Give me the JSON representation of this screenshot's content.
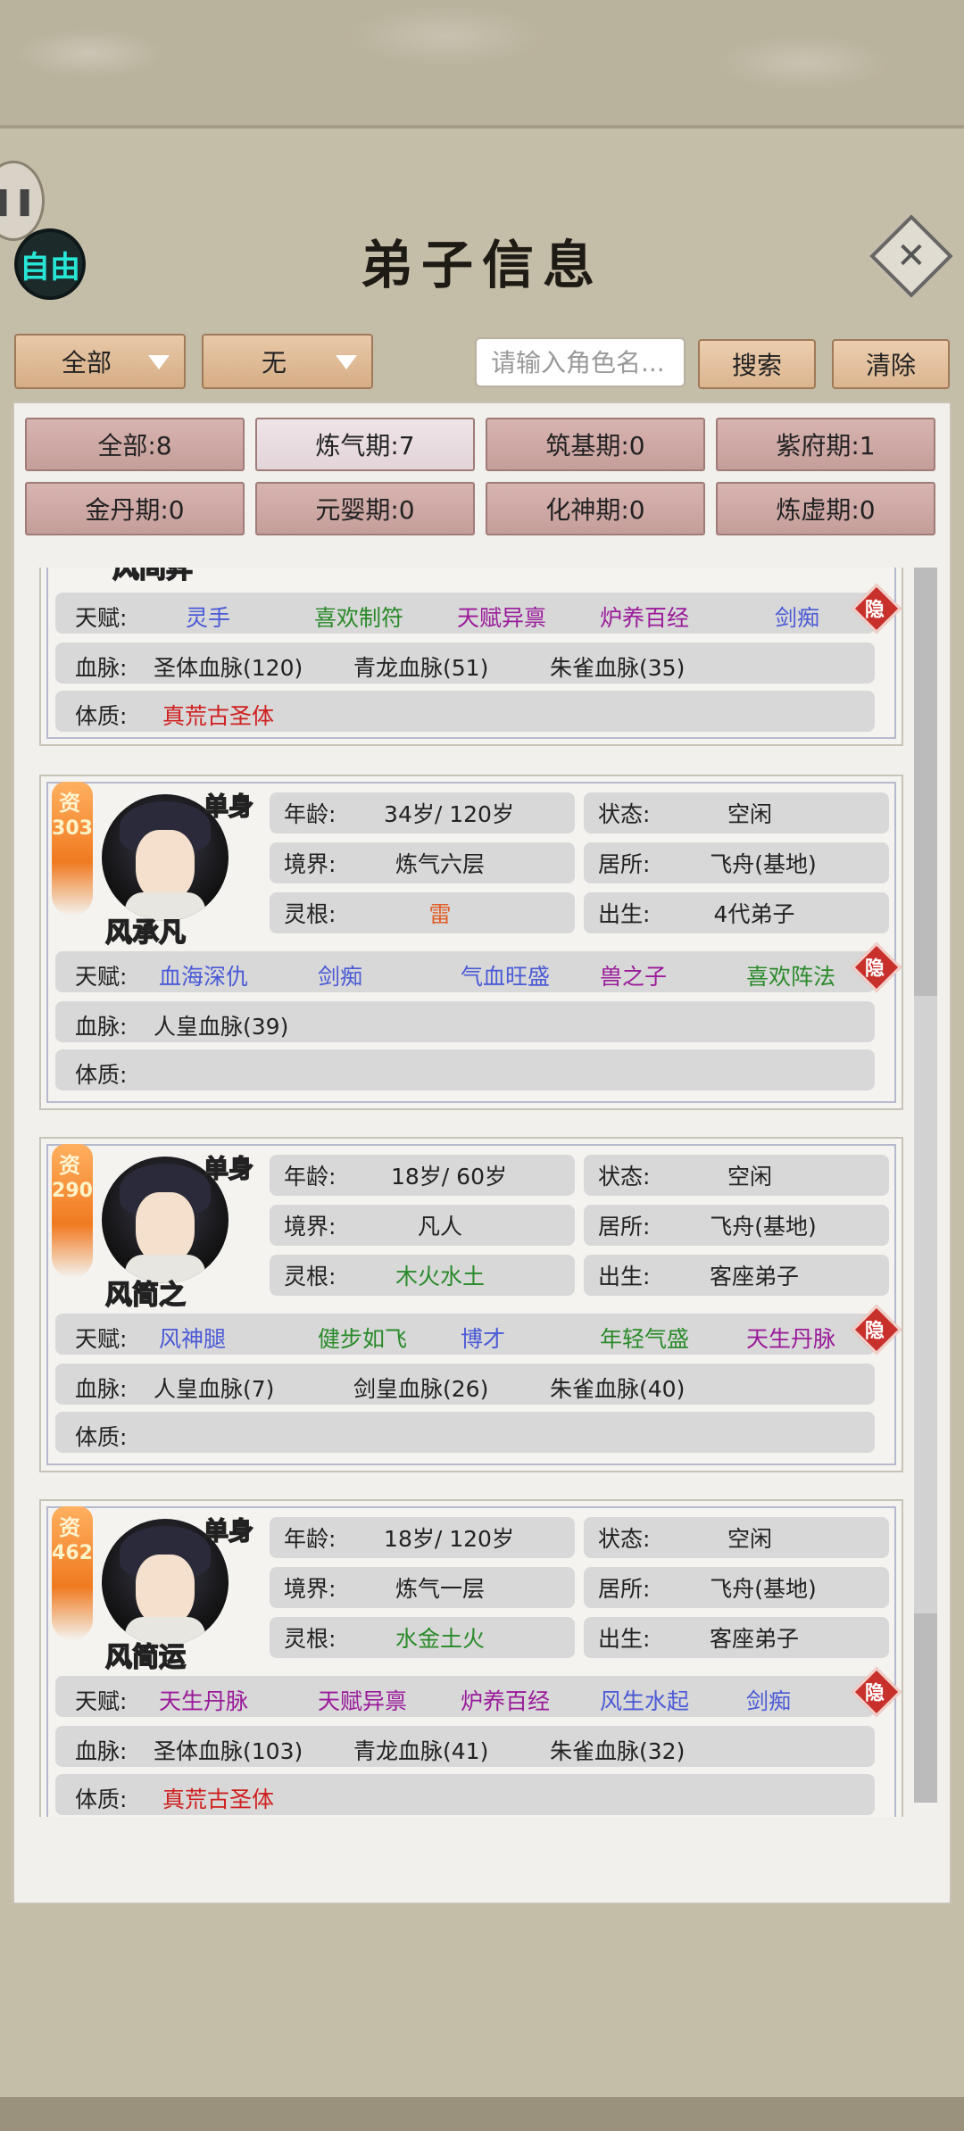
{
  "header": {
    "title": "弟子信息",
    "free_label": "自由",
    "pause_glyph": "❚❚",
    "close_glyph": "✕"
  },
  "filters": {
    "dropdown1": "全部",
    "dropdown2": "无",
    "search_placeholder": "请输入角色名...",
    "search_label": "搜索",
    "clear_label": "清除"
  },
  "realm_filters": [
    "全部:8",
    "炼气期:7",
    "筑基期:0",
    "紫府期:1",
    "金丹期:0",
    "元婴期:0",
    "化神期:0",
    "炼虚期:0"
  ],
  "labels": {
    "age": "年龄:",
    "status": "状态:",
    "realm": "境界:",
    "residence": "居所:",
    "root": "灵根:",
    "birth": "出生:",
    "talent": "天赋:",
    "bloodline": "血脉:",
    "physique": "体质:",
    "aptitude": "资",
    "single": "单身",
    "hide": "隐"
  },
  "colors": {
    "blue": "#4a5ad6",
    "green": "#2a8a2a",
    "purple": "#9a1a9a",
    "red": "#d02020",
    "orange": "#e0602a"
  },
  "partial_card": {
    "name_fragment": "风间弈",
    "talents": [
      {
        "text": "灵手",
        "color": "#4a5ad6"
      },
      {
        "text": "喜欢制符",
        "color": "#2a8a2a"
      },
      {
        "text": "天赋异禀",
        "color": "#9a1a9a"
      },
      {
        "text": "炉养百经",
        "color": "#9a1a9a"
      },
      {
        "text": "剑痴",
        "color": "#4a5ad6"
      }
    ],
    "bloodlines": [
      "圣体血脉(120)",
      "青龙血脉(51)",
      "朱雀血脉(35)"
    ],
    "physique": "真荒古圣体"
  },
  "disciples": [
    {
      "name": "风承凡",
      "aptitude": "303",
      "age": "34岁/ 120岁",
      "status": "空闲",
      "realm": "炼气六层",
      "residence": "飞舟(基地)",
      "root": "雷",
      "root_color": "#e0602a",
      "birth": "4代弟子",
      "talents": [
        {
          "text": "血海深仇",
          "color": "#4a5ad6"
        },
        {
          "text": "剑痴",
          "color": "#4a5ad6"
        },
        {
          "text": "气血旺盛",
          "color": "#4a5ad6"
        },
        {
          "text": "兽之子",
          "color": "#9a1a9a"
        },
        {
          "text": "喜欢阵法",
          "color": "#2a8a2a"
        }
      ],
      "bloodlines": [
        "人皇血脉(39)"
      ],
      "physique": ""
    },
    {
      "name": "风简之",
      "aptitude": "290",
      "age": "18岁/ 60岁",
      "status": "空闲",
      "realm": "凡人",
      "residence": "飞舟(基地)",
      "root": "木火水土",
      "root_color": "#2a8a2a",
      "birth": "客座弟子",
      "talents": [
        {
          "text": "风神腿",
          "color": "#4a5ad6"
        },
        {
          "text": "健步如飞",
          "color": "#2a8a2a"
        },
        {
          "text": "博才",
          "color": "#4a5ad6"
        },
        {
          "text": "年轻气盛",
          "color": "#2a8a2a"
        },
        {
          "text": "天生丹脉",
          "color": "#9a1a9a"
        }
      ],
      "bloodlines": [
        "人皇血脉(7)",
        "剑皇血脉(26)",
        "朱雀血脉(40)"
      ],
      "physique": ""
    },
    {
      "name": "风简运",
      "aptitude": "462",
      "age": "18岁/ 120岁",
      "status": "空闲",
      "realm": "炼气一层",
      "residence": "飞舟(基地)",
      "root": "水金土火",
      "root_color": "#2a8a2a",
      "birth": "客座弟子",
      "talents": [
        {
          "text": "天生丹脉",
          "color": "#9a1a9a"
        },
        {
          "text": "天赋异禀",
          "color": "#9a1a9a"
        },
        {
          "text": "炉养百经",
          "color": "#9a1a9a"
        },
        {
          "text": "风生水起",
          "color": "#4a5ad6"
        },
        {
          "text": "剑痴",
          "color": "#4a5ad6"
        }
      ],
      "bloodlines": [
        "圣体血脉(103)",
        "青龙血脉(41)",
        "朱雀血脉(32)"
      ],
      "physique": "真荒古圣体"
    }
  ]
}
